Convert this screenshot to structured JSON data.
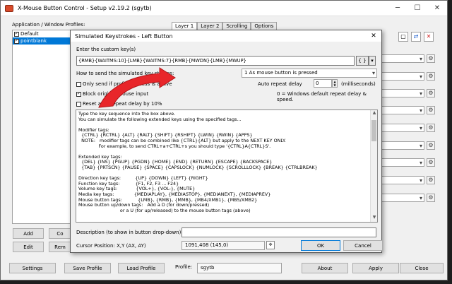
{
  "main": {
    "title": "X-Mouse Button Control - Setup v2.19.2 (sgytb)",
    "profiles_label": "Application / Window Profiles:",
    "profiles": [
      {
        "name": "Default",
        "checked": true,
        "selected": false
      },
      {
        "name": "pointblank",
        "checked": true,
        "selected": true
      }
    ],
    "tabs": [
      "Layer 1",
      "Layer 2",
      "Scrolling",
      "Options"
    ],
    "gear_glyph": "⚙",
    "buttons": {
      "add": "Add",
      "copy": "Co",
      "edit": "Edit",
      "remove": "Rem",
      "settings": "Settings",
      "save_profile": "Save Profile",
      "load_profile": "Load Profile",
      "about": "About",
      "apply": "Apply",
      "close": "Close"
    },
    "profile_label": "Profile:",
    "profile_value": "sgytb"
  },
  "dialog": {
    "title": "Simulated Keystrokes - Left Button",
    "close_glyph": "✕",
    "enter_label": "Enter the custom key(s)",
    "key_value": "{RMB}{WAITMS:10}{LMB}{WAITMS:7}{RMB}{MWDN}{LMB}{MWUP}",
    "braces_btn": "{ }",
    "how_label": "How to send the simulated key strokes:",
    "how_value": "1 As mouse button is pressed",
    "check_only": "Only send if profile process is active",
    "check_block": "Block original mouse input",
    "check_reset": "Reset auto repeat delay by 10%",
    "auto_repeat_label": "Auto repeat delay",
    "auto_repeat_value": "0",
    "ms_label": "(milliseconds)",
    "repeat_note": "0 = Windows default repeat delay & speed.",
    "help_lines": [
      "Type the key sequence into the box above.",
      "You can simulate the following extended keys using the specified tags...",
      "",
      "Modifier tags:",
      "  {CTRL} {RCTRL} {ALT} {RALT} {SHIFT} {RSHIFT} {LWIN} {RWIN} {APPS}",
      "  NOTE:   modifier tags can be combined like {CTRL}{ALT} but apply to the NEXT KEY ONLY.",
      "              For example, to send CTRL+a+CTRL+s you should type '{CTRL}A{CTRL}S'.",
      "",
      "Extended key tags:",
      "  {DEL} {INS} {PGUP} {PGDN} {HOME} {END} {RETURN} {ESCAPE} {BACKSPACE}",
      "  {TAB} {PRTSCN} {PAUSE} {SPACE} {CAPSLOCK} {NUMLOCK} {SCROLLLOCK} {BREAK} {CTRLBREAK}",
      "",
      "Direction key tags:          {UP} {DOWN} {LEFT} {RIGHT}",
      "Function key tags:           {F1, F2, F3 ... F24}",
      "Volume key tags:             {VOL+}, {VOL-}, {MUTE}",
      "Media key tags:              {MEDIAPLAY}, {MEDIASTOP}, {MEDIANEXT}, {MEDIAPREV}",
      "Mouse button tags:           {LMB}, {RMB}, {MMB}, {MB4/XMB1}, {MB5/XMB2}",
      "Mouse button up/down tags:   Add a D (for down/pressed)",
      "                             or a U (for up/released) to the mouse button tags (above)"
    ],
    "desc_label": "Description (to show in button drop-down)",
    "desc_value": "",
    "cursor_label": "Cursor Position: X,Y (AX, AY)",
    "cursor_value": "1091,408 (145,0)",
    "ok": "OK",
    "cancel": "Cancel"
  },
  "colors": {
    "annotation_arrow": "#e8262a",
    "selection": "#0078d7"
  }
}
